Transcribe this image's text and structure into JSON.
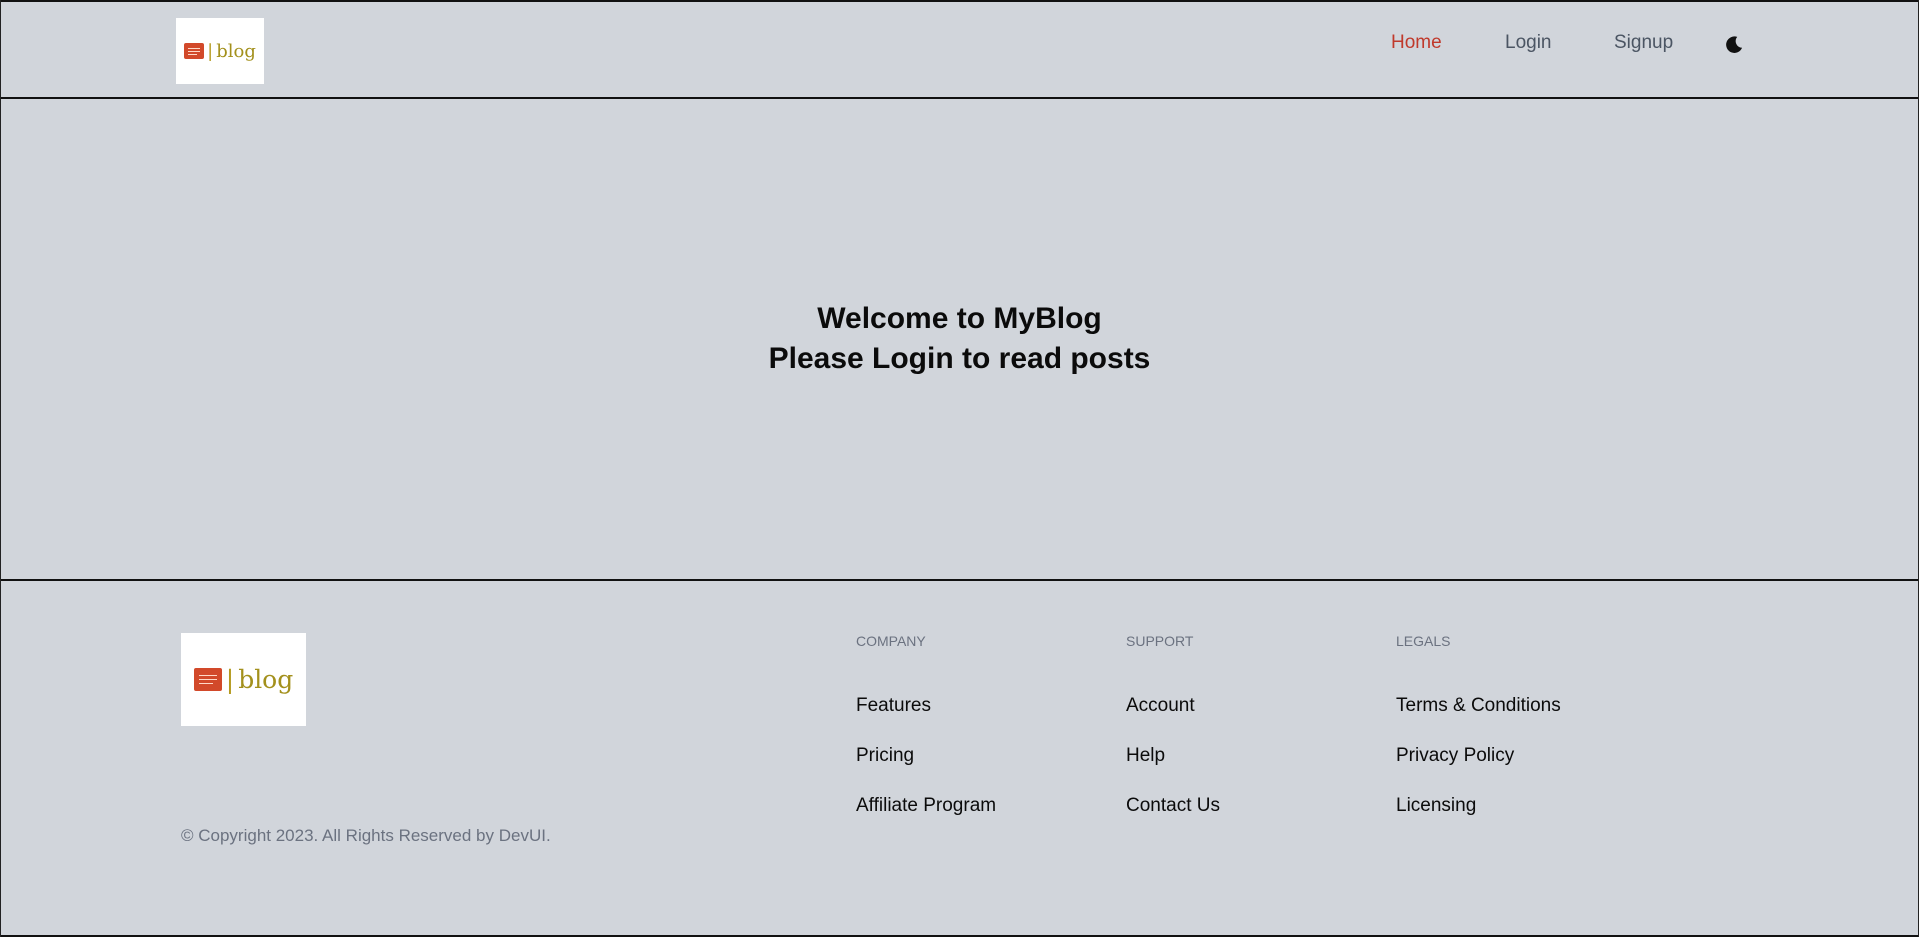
{
  "header": {
    "logo": {
      "text": "blog",
      "separator": "|"
    },
    "nav": [
      {
        "label": "Home",
        "active": true
      },
      {
        "label": "Login",
        "active": false
      },
      {
        "label": "Signup",
        "active": false
      }
    ],
    "theme_icon": "moon-icon"
  },
  "hero": {
    "line1": "Welcome to MyBlog",
    "line2": "Please Login to read posts"
  },
  "footer": {
    "logo": {
      "text": "blog",
      "separator": "|"
    },
    "copyright": "© Copyright 2023. All Rights Reserved by DevUI.",
    "columns": [
      {
        "heading": "COMPANY",
        "links": [
          "Features",
          "Pricing",
          "Affiliate Program"
        ]
      },
      {
        "heading": "SUPPORT",
        "links": [
          "Account",
          "Help",
          "Contact Us"
        ]
      },
      {
        "heading": "LEGALS",
        "links": [
          "Terms & Conditions",
          "Privacy Policy",
          "Licensing"
        ]
      }
    ]
  },
  "colors": {
    "background": "#d1d5db",
    "accent": "#c0392b",
    "logo_icon": "#d2492a",
    "logo_text": "#a3901c",
    "muted_text": "#6b7280"
  }
}
